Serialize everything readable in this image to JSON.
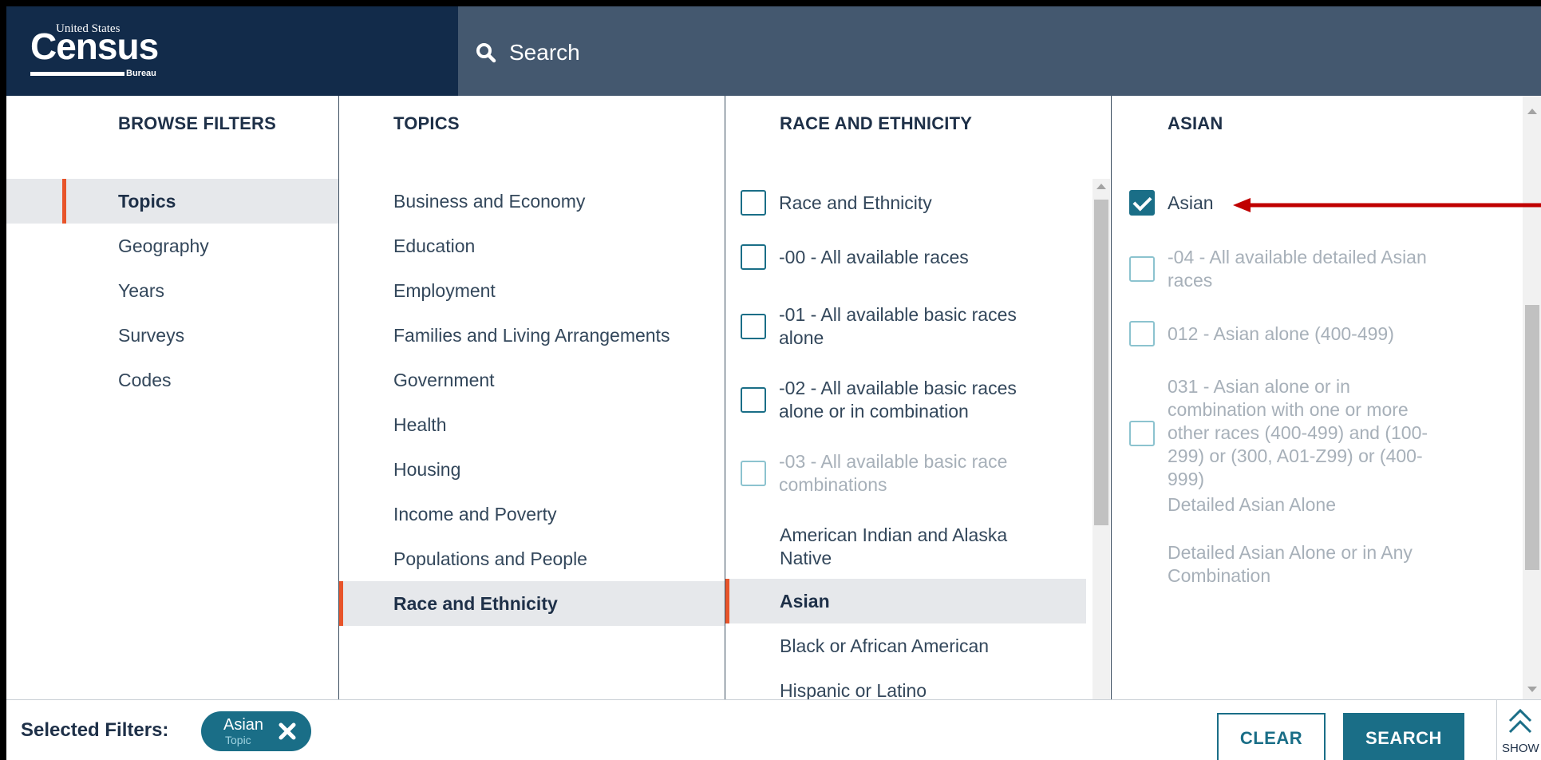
{
  "header": {
    "logo": {
      "top": "United States",
      "main": "Census",
      "bottom": "Bureau"
    },
    "search_label": "Search"
  },
  "browse_filters": {
    "heading": "BROWSE FILTERS",
    "items": [
      {
        "label": "Topics",
        "active": true
      },
      {
        "label": "Geography"
      },
      {
        "label": "Years"
      },
      {
        "label": "Surveys"
      },
      {
        "label": "Codes"
      }
    ]
  },
  "topics": {
    "heading": "TOPICS",
    "items": [
      {
        "label": "Business and Economy"
      },
      {
        "label": "Education"
      },
      {
        "label": "Employment"
      },
      {
        "label": "Families and Living Arrangements"
      },
      {
        "label": "Government"
      },
      {
        "label": "Health"
      },
      {
        "label": "Housing"
      },
      {
        "label": "Income and Poverty"
      },
      {
        "label": "Populations and People"
      },
      {
        "label": "Race and Ethnicity",
        "active": true
      }
    ]
  },
  "race_ethnicity": {
    "heading": "RACE AND ETHNICITY",
    "check_items": [
      {
        "label": "Race and Ethnicity",
        "checked": false
      },
      {
        "label": "-00 - All available races",
        "checked": false
      },
      {
        "label": "-01 - All available basic races alone",
        "checked": false
      },
      {
        "label": "-02 - All available basic races alone or in combination",
        "checked": false
      },
      {
        "label": "-03 - All available basic race combinations",
        "checked": false,
        "disabled": true
      }
    ],
    "nav_items": [
      {
        "label": "American Indian and Alaska Native"
      },
      {
        "label": "Asian",
        "active": true
      },
      {
        "label": "Black or African American"
      },
      {
        "label": "Hispanic or Latino"
      }
    ]
  },
  "asian": {
    "heading": "ASIAN",
    "check_items": [
      {
        "label": "Asian",
        "checked": true
      },
      {
        "label": "-04 - All available detailed Asian races",
        "disabled": true
      },
      {
        "label": "012 - Asian alone (400-499)",
        "disabled": true
      },
      {
        "label": "031 - Asian alone or in combination with one or more other races (400-499) and (100-299) or (300, A01-Z99) or (400-999)",
        "disabled": true
      }
    ],
    "plain_items": [
      {
        "label": "Detailed Asian Alone"
      },
      {
        "label": "Detailed Asian Alone or in Any Combination"
      }
    ]
  },
  "footer": {
    "selected_label": "Selected Filters:",
    "chip": {
      "label": "Asian",
      "sublabel": "Topic"
    },
    "clear_label": "CLEAR",
    "search_label": "SEARCH",
    "show_label": "SHOW"
  },
  "colors": {
    "header_dark": "#122b4a",
    "header": "#44586f",
    "teal": "#1a6e87",
    "accent": "#e8542a",
    "annotation": "#c00000"
  }
}
